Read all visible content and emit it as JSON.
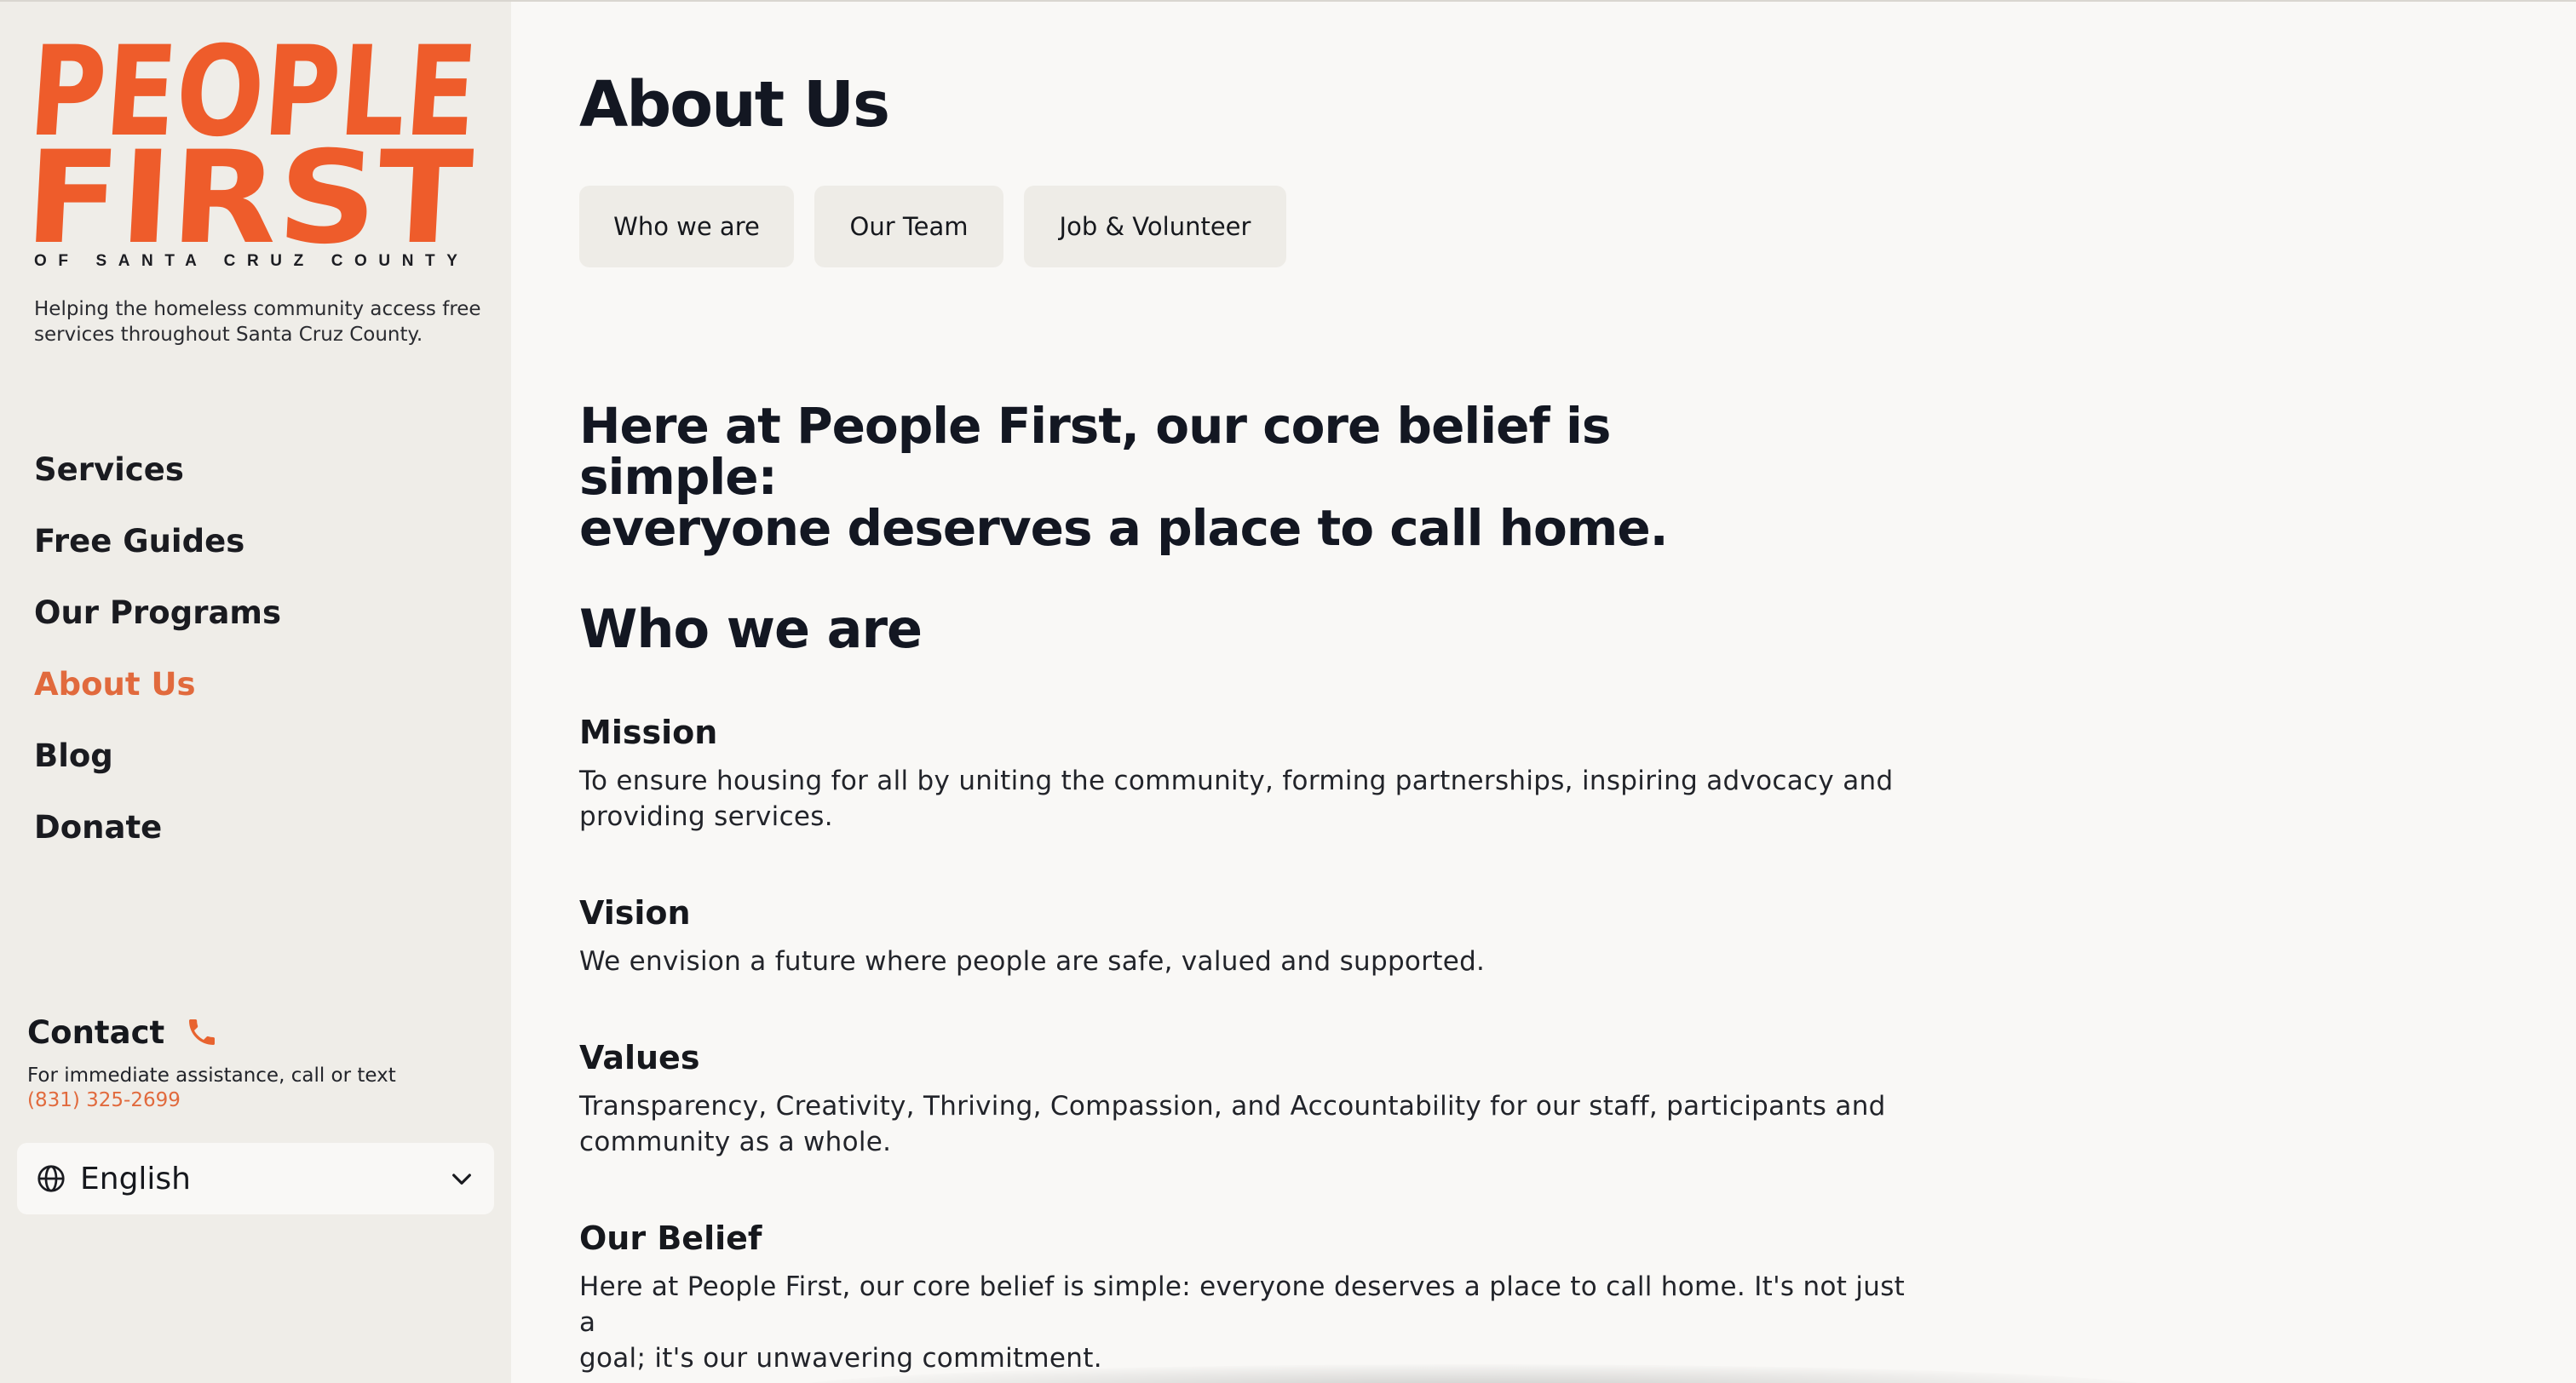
{
  "colors": {
    "brand_orange": "#ee5c2b",
    "accent_orange": "#e16a3d",
    "sidebar_bg": "#efede8",
    "main_bg": "#f9f8f6",
    "text_dark": "#131722"
  },
  "sidebar": {
    "logo": {
      "line1": "PEOPLE",
      "line2": "FIRST",
      "subline": "OF SANTA CRUZ COUNTY"
    },
    "tagline": "Helping the homeless community access free services throughout Santa Cruz County.",
    "nav": [
      {
        "label": "Services",
        "active": false
      },
      {
        "label": "Free Guides",
        "active": false
      },
      {
        "label": "Our Programs",
        "active": false
      },
      {
        "label": "About Us",
        "active": true
      },
      {
        "label": "Blog",
        "active": false
      },
      {
        "label": "Donate",
        "active": false
      }
    ],
    "contact": {
      "title": "Contact",
      "icon": "phone-icon",
      "note": "For immediate assistance, call or text",
      "phone": "(831) 325-2699"
    },
    "language": {
      "icon": "globe-icon",
      "value": "English",
      "dropdown_icon": "chevron-down-icon"
    }
  },
  "main": {
    "title": "About Us",
    "tabs": [
      {
        "label": "Who we are"
      },
      {
        "label": "Our Team"
      },
      {
        "label": "Job & Volunteer"
      }
    ],
    "lede_line1": "Here at People First, our core belief is simple:",
    "lede_line2": "everyone deserves a place to call home.",
    "section_title": "Who we are",
    "blocks": [
      {
        "heading": "Mission",
        "text_line1": "To ensure housing for all by uniting the community, forming partnerships, inspiring advocacy and",
        "text_line2": "providing services."
      },
      {
        "heading": "Vision",
        "text_line1": "We envision a future where people are safe, valued and supported.",
        "text_line2": ""
      },
      {
        "heading": "Values",
        "text_line1": "Transparency, Creativity, Thriving, Compassion, and Accountability for our staff, participants and",
        "text_line2": "community as a whole."
      },
      {
        "heading": "Our Belief",
        "text_line1": "Here at People First, our core belief is simple: everyone deserves a place to call home. It's not just a",
        "text_line2": "goal; it's our unwavering commitment."
      }
    ]
  }
}
